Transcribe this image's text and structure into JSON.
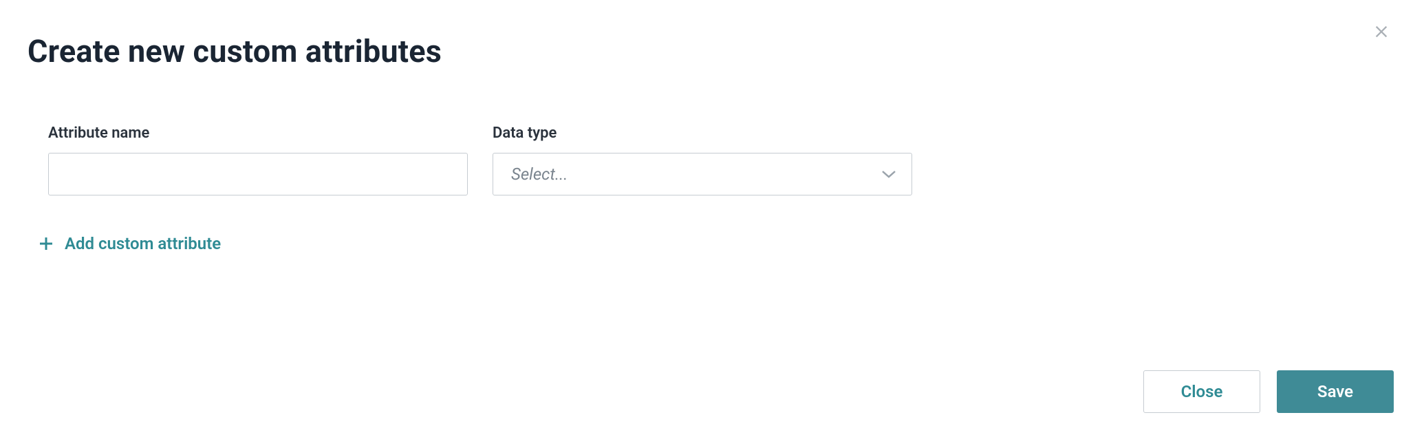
{
  "dialog": {
    "title": "Create new custom attributes"
  },
  "fields": {
    "attribute_name": {
      "label": "Attribute name",
      "value": ""
    },
    "data_type": {
      "label": "Data type",
      "placeholder": "Select..."
    }
  },
  "actions": {
    "add_attribute": "Add custom attribute",
    "close": "Close",
    "save": "Save"
  }
}
